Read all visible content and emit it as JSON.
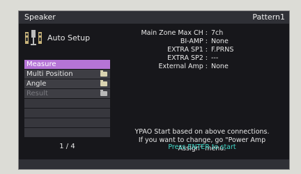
{
  "header": {
    "title": "Speaker",
    "pattern": "Pattern1"
  },
  "setup": {
    "label": "Auto Setup",
    "icon": "speaker-setup-icon"
  },
  "menu": {
    "items": [
      {
        "label": "Measure",
        "state": "selected"
      },
      {
        "label": "Multi Position",
        "state": "normal",
        "icon": "folder-icon"
      },
      {
        "label": "Angle",
        "state": "normal",
        "icon": "folder-icon"
      },
      {
        "label": "Result",
        "state": "disabled",
        "icon": "folder-icon"
      }
    ],
    "page": "1 / 4"
  },
  "info": {
    "rows": [
      {
        "label": "Main Zone Max CH :",
        "value": "7ch"
      },
      {
        "label": "BI-AMP :",
        "value": "None"
      },
      {
        "label": "EXTRA SP1 :",
        "value": "F.PRNS"
      },
      {
        "label": "EXTRA SP2 :",
        "value": "---"
      },
      {
        "label": "External Amp :",
        "value": "None"
      }
    ]
  },
  "message": {
    "line1": "YPAO Start based on above connections.",
    "line2": "If you want to change, go \"Power Amp",
    "line3": "Assign\" menu.",
    "enter": "Press ENTER to start"
  },
  "colors": {
    "selected": "#b574d6",
    "enter": "#3fd8c8",
    "background": "#17171b"
  }
}
